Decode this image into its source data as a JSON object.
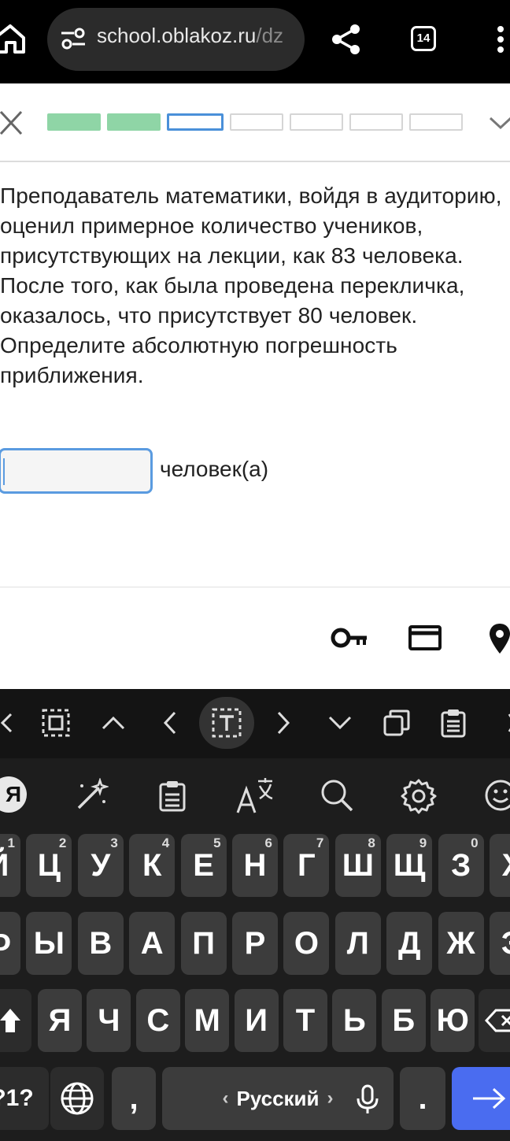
{
  "browser": {
    "url_main": "school.oblakoz.ru",
    "url_dim": "/dz",
    "tabs_count": "14"
  },
  "progress": {
    "segments": [
      "done",
      "done",
      "current",
      "todo",
      "todo",
      "todo",
      "todo"
    ]
  },
  "question": {
    "text": "Преподаватель математики, войдя в аудиторию, оценил примерное количество учеников, присутствующих на лекции, как 83 человека. После того, как была проведена перекличка, оказалось, что присутствует 80 человек. Определите абсолютную погрешность приближения."
  },
  "answer": {
    "value": "",
    "unit": "человек(а)"
  },
  "autofill": {
    "icons": [
      "key-icon",
      "credit-card-icon",
      "location-pin-icon"
    ]
  },
  "keyboard": {
    "row1": [
      {
        "k": "Й",
        "n": "1"
      },
      {
        "k": "Ц",
        "n": "2"
      },
      {
        "k": "У",
        "n": "3"
      },
      {
        "k": "К",
        "n": "4"
      },
      {
        "k": "Е",
        "n": "5"
      },
      {
        "k": "Н",
        "n": "6"
      },
      {
        "k": "Г",
        "n": "7"
      },
      {
        "k": "Ш",
        "n": "8"
      },
      {
        "k": "Щ",
        "n": "9"
      },
      {
        "k": "З",
        "n": "0"
      },
      {
        "k": "Х",
        "n": ""
      }
    ],
    "row2": [
      "Ф",
      "Ы",
      "В",
      "А",
      "П",
      "Р",
      "О",
      "Л",
      "Д",
      "Ж",
      "Э"
    ],
    "row3": [
      "Я",
      "Ч",
      "С",
      "М",
      "И",
      "Т",
      "Ь",
      "Б",
      "Ю"
    ],
    "symbols_key": "?1?",
    "comma_key": ",",
    "language_label": "Русский",
    "period_key": ".",
    "yandex_key": "Я"
  },
  "colors": {
    "done": "#8fd5a6",
    "current": "#4a90d9",
    "accent": "#4a6cf0"
  }
}
